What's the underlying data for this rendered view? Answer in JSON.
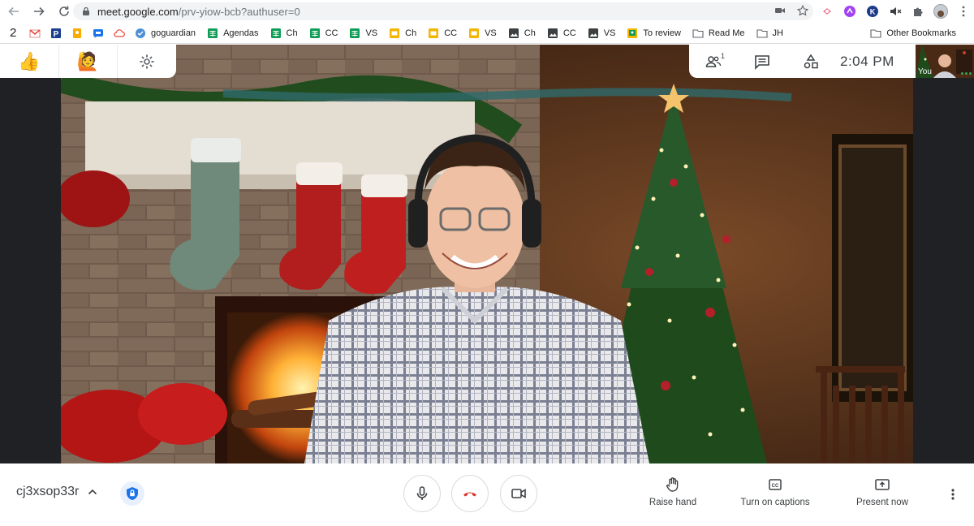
{
  "browser": {
    "url_host": "meet.google.com",
    "url_path": "/prv-yiow-bcb?authuser=0",
    "nav": {
      "back_icon": "arrow-left-icon",
      "forward_icon": "arrow-right-icon",
      "reload_icon": "reload-icon"
    },
    "extensions": [
      "camera-icon",
      "star-icon",
      "airtable-icon",
      "magnet-icon",
      "k-icon",
      "mute-icon",
      "puzzle-icon",
      "profile-avatar",
      "kebab-icon"
    ]
  },
  "bookmarks": {
    "count_label": "2",
    "items": [
      {
        "label": "",
        "icon": "gmail-icon",
        "color": "#ea4335",
        "glyph": "M"
      },
      {
        "label": "",
        "icon": "p-icon",
        "color": "#1a3f8f",
        "glyph": "P"
      },
      {
        "label": "",
        "icon": "keep-icon",
        "color": "#f9ab00",
        "glyph": ""
      },
      {
        "label": "",
        "icon": "chat-icon",
        "color": "#1a73e8",
        "glyph": ""
      },
      {
        "label": "",
        "icon": "cloud-icon",
        "color": "#ea4335",
        "glyph": ""
      },
      {
        "label": "goguardian",
        "icon": "goguardian-icon",
        "color": "#4a90d9",
        "glyph": ""
      },
      {
        "label": "Agendas",
        "icon": "sheets-icon",
        "color": "#0f9d58",
        "glyph": ""
      },
      {
        "label": "Ch",
        "icon": "sheets-icon",
        "color": "#0f9d58",
        "glyph": ""
      },
      {
        "label": "CC",
        "icon": "sheets-icon",
        "color": "#0f9d58",
        "glyph": ""
      },
      {
        "label": "VS",
        "icon": "sheets-icon",
        "color": "#0f9d58",
        "glyph": ""
      },
      {
        "label": "Ch",
        "icon": "slides-icon",
        "color": "#f4b400",
        "glyph": ""
      },
      {
        "label": "CC",
        "icon": "slides-icon",
        "color": "#f4b400",
        "glyph": ""
      },
      {
        "label": "VS",
        "icon": "slides-icon",
        "color": "#f4b400",
        "glyph": ""
      },
      {
        "label": "Ch",
        "icon": "image-icon",
        "color": "#3c4043",
        "glyph": ""
      },
      {
        "label": "CC",
        "icon": "image-icon",
        "color": "#3c4043",
        "glyph": ""
      },
      {
        "label": "VS",
        "icon": "image-icon",
        "color": "#3c4043",
        "glyph": ""
      },
      {
        "label": "To review",
        "icon": "classroom-icon",
        "color": "#0f9d58",
        "glyph": ""
      },
      {
        "label": "Read Me",
        "icon": "folder-icon",
        "color": "#5f6368",
        "glyph": ""
      },
      {
        "label": "JH",
        "icon": "folder-icon",
        "color": "#5f6368",
        "glyph": ""
      }
    ],
    "other": {
      "label": "Other Bookmarks",
      "icon": "folder-icon"
    }
  },
  "meet": {
    "reactions": [
      "thumbs-up-icon",
      "raise-hand-emoji-icon",
      "settings-icon"
    ],
    "reaction_emojis": [
      "👍",
      "🙋"
    ],
    "toolbar": {
      "people_icon": "people-icon",
      "people_count": "1",
      "chat_icon": "chat-icon",
      "activities_icon": "activities-icon",
      "time": "2:04  PM"
    },
    "self_view": {
      "label": "You"
    },
    "meeting_code": "cj3xsop33r",
    "controls": {
      "mic_icon": "microphone-icon",
      "end_call_icon": "end-call-icon",
      "camera_icon": "camera-icon",
      "end_call_color": "#d93025"
    },
    "actions": {
      "raise_hand": "Raise hand",
      "captions": "Turn on captions",
      "present": "Present now"
    }
  }
}
